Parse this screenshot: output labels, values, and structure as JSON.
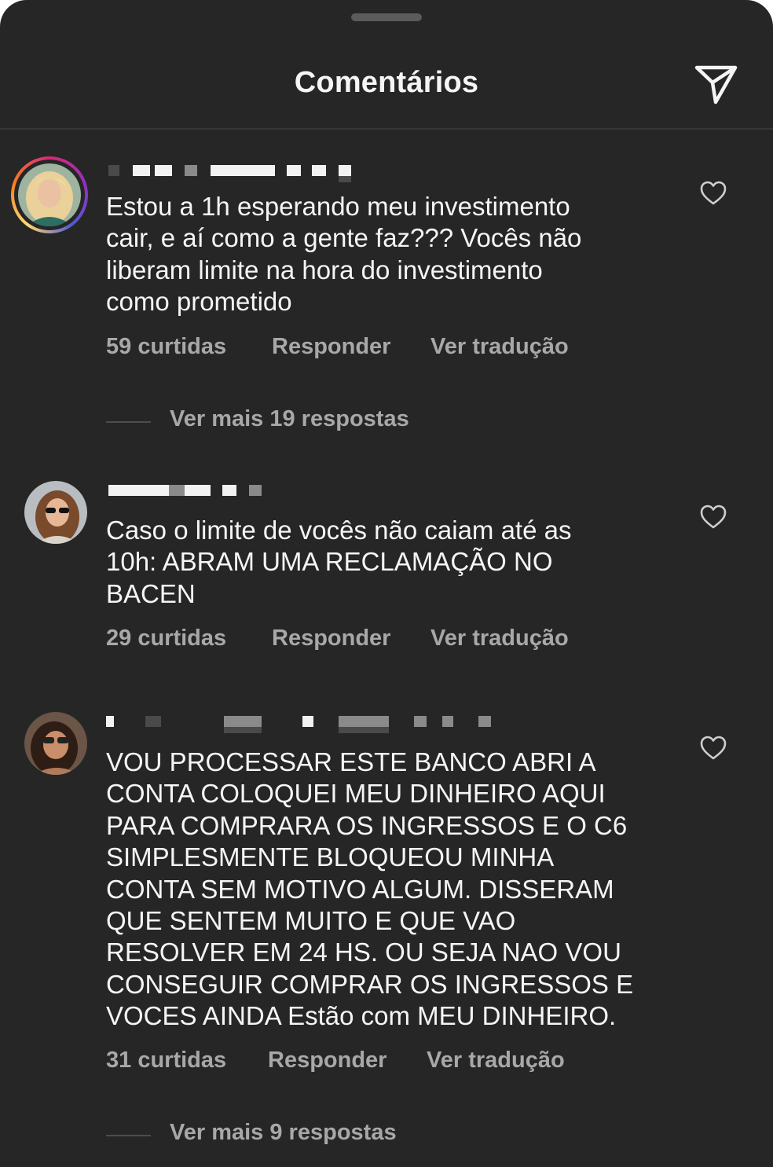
{
  "header": {
    "title": "Comentários"
  },
  "comments": [
    {
      "text": "Estou a 1h esperando meu investimento\ncair, e aí como a gente faz??? Vocês não\nliberam limite na hora do investimento\ncomo prometido",
      "likes": "59 curtidas",
      "reply": "Responder",
      "translate": "Ver tradução",
      "more_replies": "Ver mais 19 respostas"
    },
    {
      "text": "Caso o limite de vocês não caiam até as\n10h: ABRAM UMA RECLAMAÇÃO NO\nBACEN",
      "likes": "29 curtidas",
      "reply": "Responder",
      "translate": "Ver tradução"
    },
    {
      "text": "VOU PROCESSAR ESTE BANCO ABRI A\nCONTA COLOQUEI MEU DINHEIRO AQUI\nPARA COMPRARA OS INGRESSOS E O C6\nSIMPLESMENTE BLOQUEOU MINHA\nCONTA SEM MOTIVO ALGUM. DISSERAM\nQUE SENTEM MUITO E QUE VAO\nRESOLVER EM 24 HS. OU SEJA NAO VOU\nCONSEGUIR COMPRAR OS INGRESSOS E\nVOCES AINDA Estão com  MEU DINHEIRO.",
      "likes": "31 curtidas",
      "reply": "Responder",
      "translate": "Ver tradução",
      "more_replies": "Ver mais 9 respostas"
    }
  ],
  "icons": {
    "share": "paper-plane-icon",
    "like": "heart-outline-icon"
  },
  "colors": {
    "background": "#262626",
    "text": "#f5f5f5",
    "secondary_text": "#a8a8a8"
  }
}
